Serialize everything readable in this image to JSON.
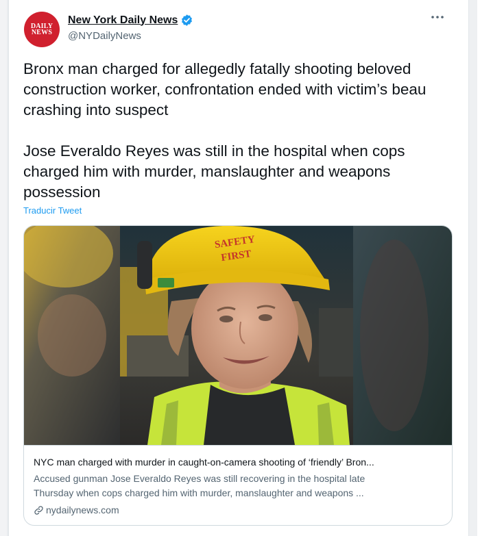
{
  "tweet": {
    "author": {
      "display_name": "New York Daily News",
      "handle": "@NYDailyNews",
      "avatar_text": [
        "DAILY",
        "NEWS"
      ],
      "verified": true
    },
    "text": "Bronx man charged for allegedly fatally shooting beloved construction worker, confrontation ended with victim’s beau crashing into suspect\n\nJose Everaldo Reyes was still in the hospital when cops charged him with murder, manslaughter and weapons possession",
    "translate_label": "Traducir Tweet",
    "more_icon": "more-horizontal-icon"
  },
  "link_card": {
    "image": {
      "helmet_text": [
        "SAFETY",
        "FIRST"
      ]
    },
    "title": "NYC man charged with murder in caught-on-camera shooting of ‘friendly’ Bron...",
    "description_lines": [
      "Accused gunman Jose Everaldo Reyes was still recovering in the hospital late",
      "Thursday when cops charged him with murder, manslaughter and weapons ..."
    ],
    "domain": "nydailynews.com",
    "domain_icon": "link-icon"
  },
  "colors": {
    "accent": "#1d9bf0",
    "brand_red": "#d0202e",
    "text_primary": "#0f1419",
    "text_secondary": "#536471",
    "border": "#cfd9de"
  }
}
